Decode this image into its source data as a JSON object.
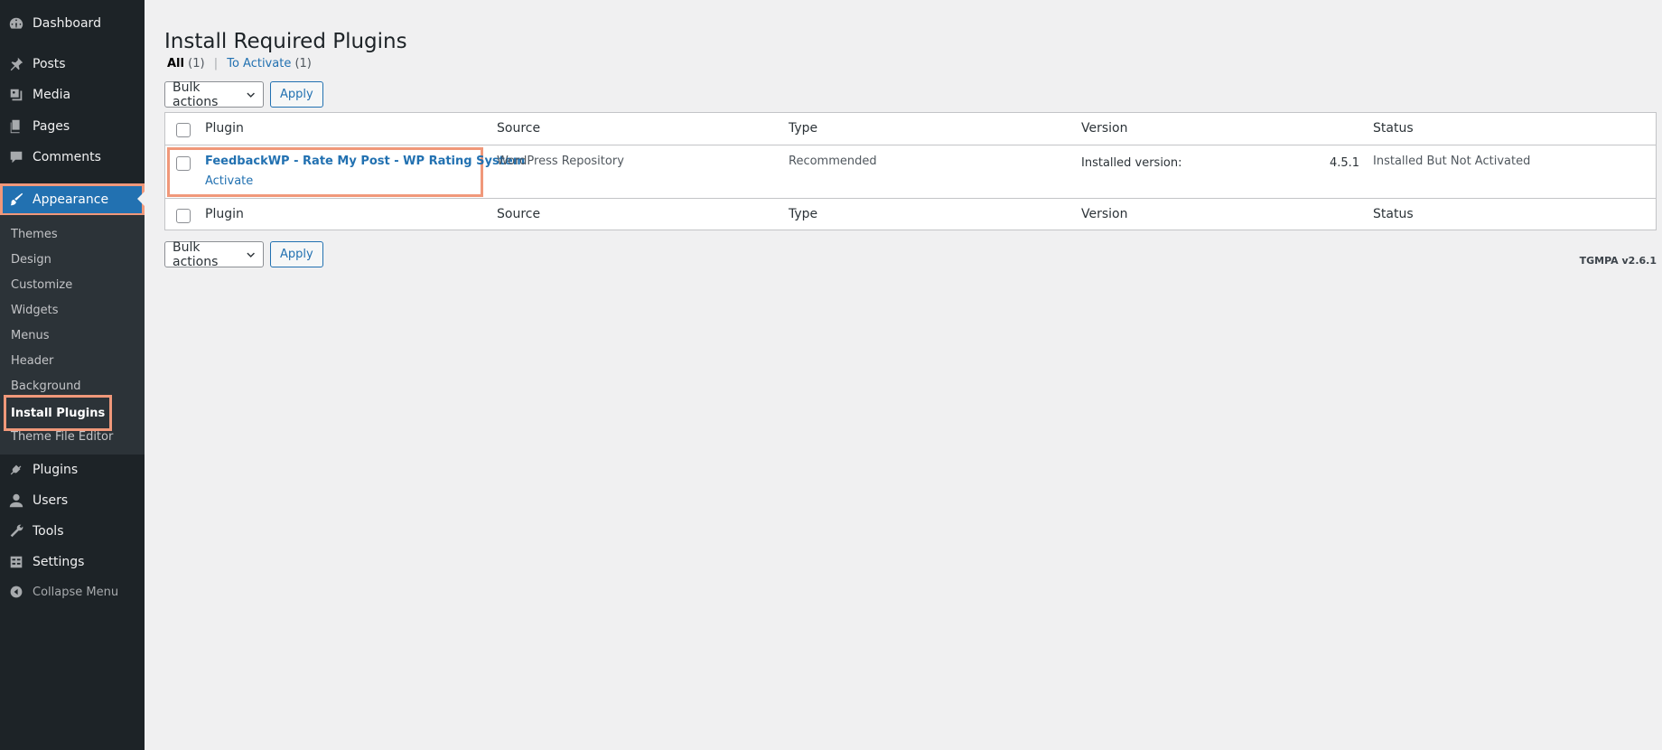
{
  "sidebar": {
    "items": [
      {
        "label": "Dashboard",
        "icon": "dashboard-icon"
      },
      {
        "label": "Posts",
        "icon": "pin-icon"
      },
      {
        "label": "Media",
        "icon": "media-icon"
      },
      {
        "label": "Pages",
        "icon": "pages-icon"
      },
      {
        "label": "Comments",
        "icon": "comment-icon"
      },
      {
        "label": "Appearance",
        "icon": "brush-icon"
      },
      {
        "label": "Plugins",
        "icon": "plug-icon"
      },
      {
        "label": "Users",
        "icon": "user-icon"
      },
      {
        "label": "Tools",
        "icon": "wrench-icon"
      },
      {
        "label": "Settings",
        "icon": "settings-icon"
      },
      {
        "label": "Collapse Menu",
        "icon": "collapse-icon"
      }
    ],
    "submenu": [
      "Themes",
      "Design",
      "Customize",
      "Widgets",
      "Menus",
      "Header",
      "Background",
      "Install Plugins",
      "Theme File Editor"
    ]
  },
  "main": {
    "title": "Install Required Plugins",
    "views": {
      "all_label": "All",
      "all_count": "(1)",
      "separator": "|",
      "activate_label": "To Activate",
      "activate_count": "(1)"
    },
    "bulk_label": "Bulk actions",
    "apply_label": "Apply",
    "table": {
      "columns": [
        "Plugin",
        "Source",
        "Type",
        "Version",
        "Status"
      ],
      "rows": [
        {
          "plugin": "FeedbackWP - Rate My Post - WP Rating System",
          "action": "Activate",
          "source": "WordPress Repository",
          "type": "Recommended",
          "installed_label": "Installed version:",
          "version": "4.5.1",
          "status": "Installed But Not Activated"
        }
      ]
    },
    "footer_version": "TGMPA v2.6.1"
  }
}
